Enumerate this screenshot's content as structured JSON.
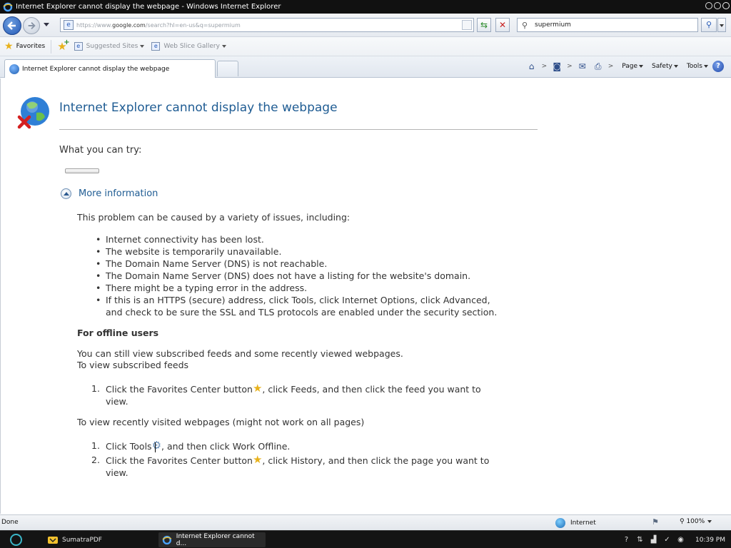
{
  "window": {
    "title": "Internet Explorer cannot display the webpage - Windows Internet Explorer"
  },
  "navigation": {
    "address_prefix": "https://www.",
    "address_domain": "google.com",
    "address_path": "/search?hl=en-us&q=supermium",
    "search_value": "supermium"
  },
  "favorites_bar": {
    "favorites_label": "Favorites",
    "links": [
      {
        "label": "Suggested Sites"
      },
      {
        "label": "Web Slice Gallery"
      }
    ]
  },
  "tabs": [
    {
      "label": "Internet Explorer cannot display the webpage"
    }
  ],
  "command_bar": {
    "page_label": "Page",
    "safety_label": "Safety",
    "tools_label": "Tools",
    "help_label": "?",
    "chevron": ">"
  },
  "content": {
    "title": "Internet Explorer cannot display the webpage",
    "what_you_can_try": "What you can try:",
    "more_information": "More information",
    "intro": "This problem can be caused by a variety of issues, including:",
    "causes": [
      "Internet connectivity has been lost.",
      "The website is temporarily unavailable.",
      "The Domain Name Server (DNS) is not reachable.",
      "The Domain Name Server (DNS) does not have a listing for the website's domain.",
      "There might be a typing error in the address.",
      "If this is an HTTPS (secure) address, click Tools, click Internet Options, click Advanced,",
      "and check to be sure the SSL and TLS protocols are enabled under the security section."
    ],
    "offline_heading": "For offline users",
    "offline_text_1": "You can still view subscribed feeds and some recently viewed webpages.",
    "offline_text_2": "To view subscribed feeds",
    "feeds_step_num": "1.",
    "feeds_step_a": "Click the Favorites Center button",
    "feeds_step_b": ", click Feeds, and then click the feed you want to",
    "feeds_step_c": "view.",
    "recent_heading": "To view recently visited webpages (might not work on all pages)",
    "recent_step1_num": "1.",
    "recent_step1_a": "Click Tools",
    "recent_step1_b": ", and then click Work Offline.",
    "recent_step2_num": "2.",
    "recent_step2_a": "Click the Favorites Center button",
    "recent_step2_b": ", click History, and then click the page you want to",
    "recent_step2_c": "view."
  },
  "status_bar": {
    "status": "Done",
    "zone": "Internet",
    "zoom": "100%"
  },
  "taskbar": {
    "tasks": [
      {
        "label": "SumatraPDF"
      },
      {
        "label": "Internet Explorer cannot d..."
      }
    ],
    "clock": "10:39 PM"
  },
  "colors": {
    "accent_blue": "#1f5c93",
    "star_yellow": "#e8b21c"
  }
}
